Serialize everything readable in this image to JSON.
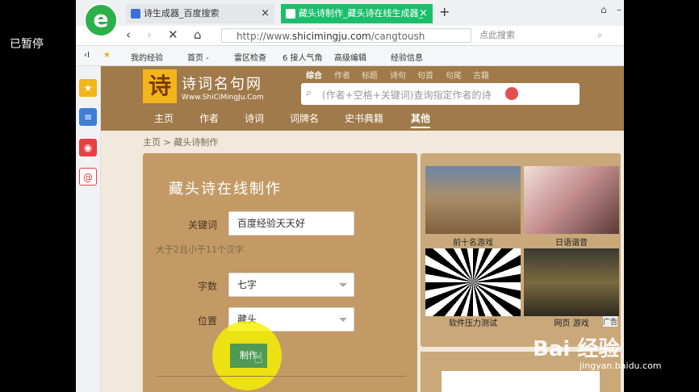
{
  "overlay": {
    "paused_label": "已暂停"
  },
  "browser": {
    "tabs": [
      {
        "label": "诗生成器_百度搜索",
        "close": "×"
      },
      {
        "label": "藏头诗制作_藏头诗在线生成器_",
        "close": "×"
      }
    ],
    "new_tab": "+",
    "url_prefix": "http://www.",
    "url_host": "shicimingju.com",
    "url_path": "/cangtoush",
    "search_placeholder": "点此搜索",
    "bookmarks": [
      "我的经验",
      "首页 -",
      "雷区检查",
      "6 接人气角",
      "高级编辑",
      "经验信息"
    ]
  },
  "site": {
    "logo_char": "诗",
    "logo_title": "诗词名句网",
    "logo_url": "Www.ShiCiMingJu.Com",
    "search_categories": [
      "综合",
      "作者",
      "标题",
      "诗句",
      "句首",
      "句尾",
      "古籍"
    ],
    "search_placeholder": "(作者+空格+关键词)查询指定作者的诗",
    "nav": [
      "主页",
      "作者",
      "诗词",
      "词牌名",
      "史书典籍",
      "其他"
    ],
    "breadcrumb": "主页 > 藏头诗制作",
    "form": {
      "title": "藏头诗在线制作",
      "keyword_label": "关键词",
      "keyword_value": "百度经验天天好",
      "hint": "大于2且小于11个汉字",
      "chars_label": "字数",
      "chars_value": "七字",
      "position_label": "位置",
      "position_value": "藏头",
      "submit_label": "制作"
    },
    "ads": [
      {
        "caption": "前十名游戏"
      },
      {
        "caption": "日语谐音"
      },
      {
        "caption": "软件压力测试"
      },
      {
        "caption": "网页 游戏"
      }
    ],
    "ad_tag": "广告"
  },
  "watermark": {
    "brand": "Bai  经验",
    "url": "jingyan.baidu.com"
  }
}
